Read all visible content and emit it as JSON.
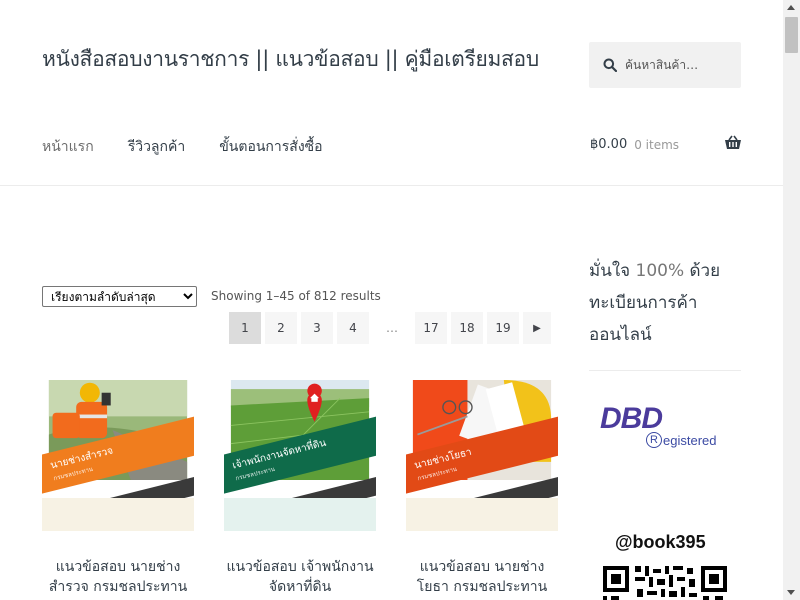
{
  "header": {
    "site_title": "หนังสือสอบงานราชการ || แนวข้อสอบ || คู่มือเตรียมสอบ",
    "search_placeholder": "ค้นหาสินค้า…",
    "search_icon": "search-icon"
  },
  "nav": {
    "items": [
      {
        "label": "หน้าแรก"
      },
      {
        "label": "รีวิวลูกค้า"
      },
      {
        "label": "ขั้นตอนการสั่งซื้อ"
      }
    ]
  },
  "cart": {
    "amount": "฿0.00",
    "count": "0 items",
    "icon": "basket-icon"
  },
  "shop": {
    "sort_selected": "เรียงตามลำดับล่าสุด",
    "result_count": "Showing 1–45 of 812 results",
    "pagination": [
      "1",
      "2",
      "3",
      "4",
      "…",
      "17",
      "18",
      "19"
    ],
    "current_page": "1"
  },
  "products": [
    {
      "title": "แนวข้อสอบ นายช่างสำรวจ กรมชลประทาน",
      "cover_label": "นายช่างสำรวจ",
      "cover_sub": "กรมชลประทาน",
      "colors": {
        "band": "#f07d1e",
        "photo": "#8aa86a"
      }
    },
    {
      "title": "แนวข้อสอบ เจ้าพนักงานจัดหาที่ดิน",
      "cover_label": "เจ้าพนักงานจัดหาที่ดิน",
      "cover_sub": "กรมชลประทาน",
      "colors": {
        "band": "#0f6b4a",
        "photo": "#6aa444"
      }
    },
    {
      "title": "แนวข้อสอบ นายช่างโยธา กรมชลประทาน",
      "cover_label": "นายช่างโยธา",
      "cover_sub": "กรมชลประทาน",
      "colors": {
        "band": "#e24a16",
        "photo": "#d7d2c6"
      }
    }
  ],
  "sidebar": {
    "heading_pre": "มั่นใจ",
    "heading_pct": "100%",
    "heading_post": "ด้วยทะเบียนการค้าออนไลน์",
    "dbd_text": "DBD",
    "dbd_reg_letter": "R",
    "dbd_reg_text": "egistered",
    "line_id": "@book395"
  },
  "colors": {
    "text": "#333e48",
    "dbd_purple": "#4b3b9c",
    "page_bg": "#f6f6f6",
    "page_current_bg": "#dcdcdc"
  }
}
